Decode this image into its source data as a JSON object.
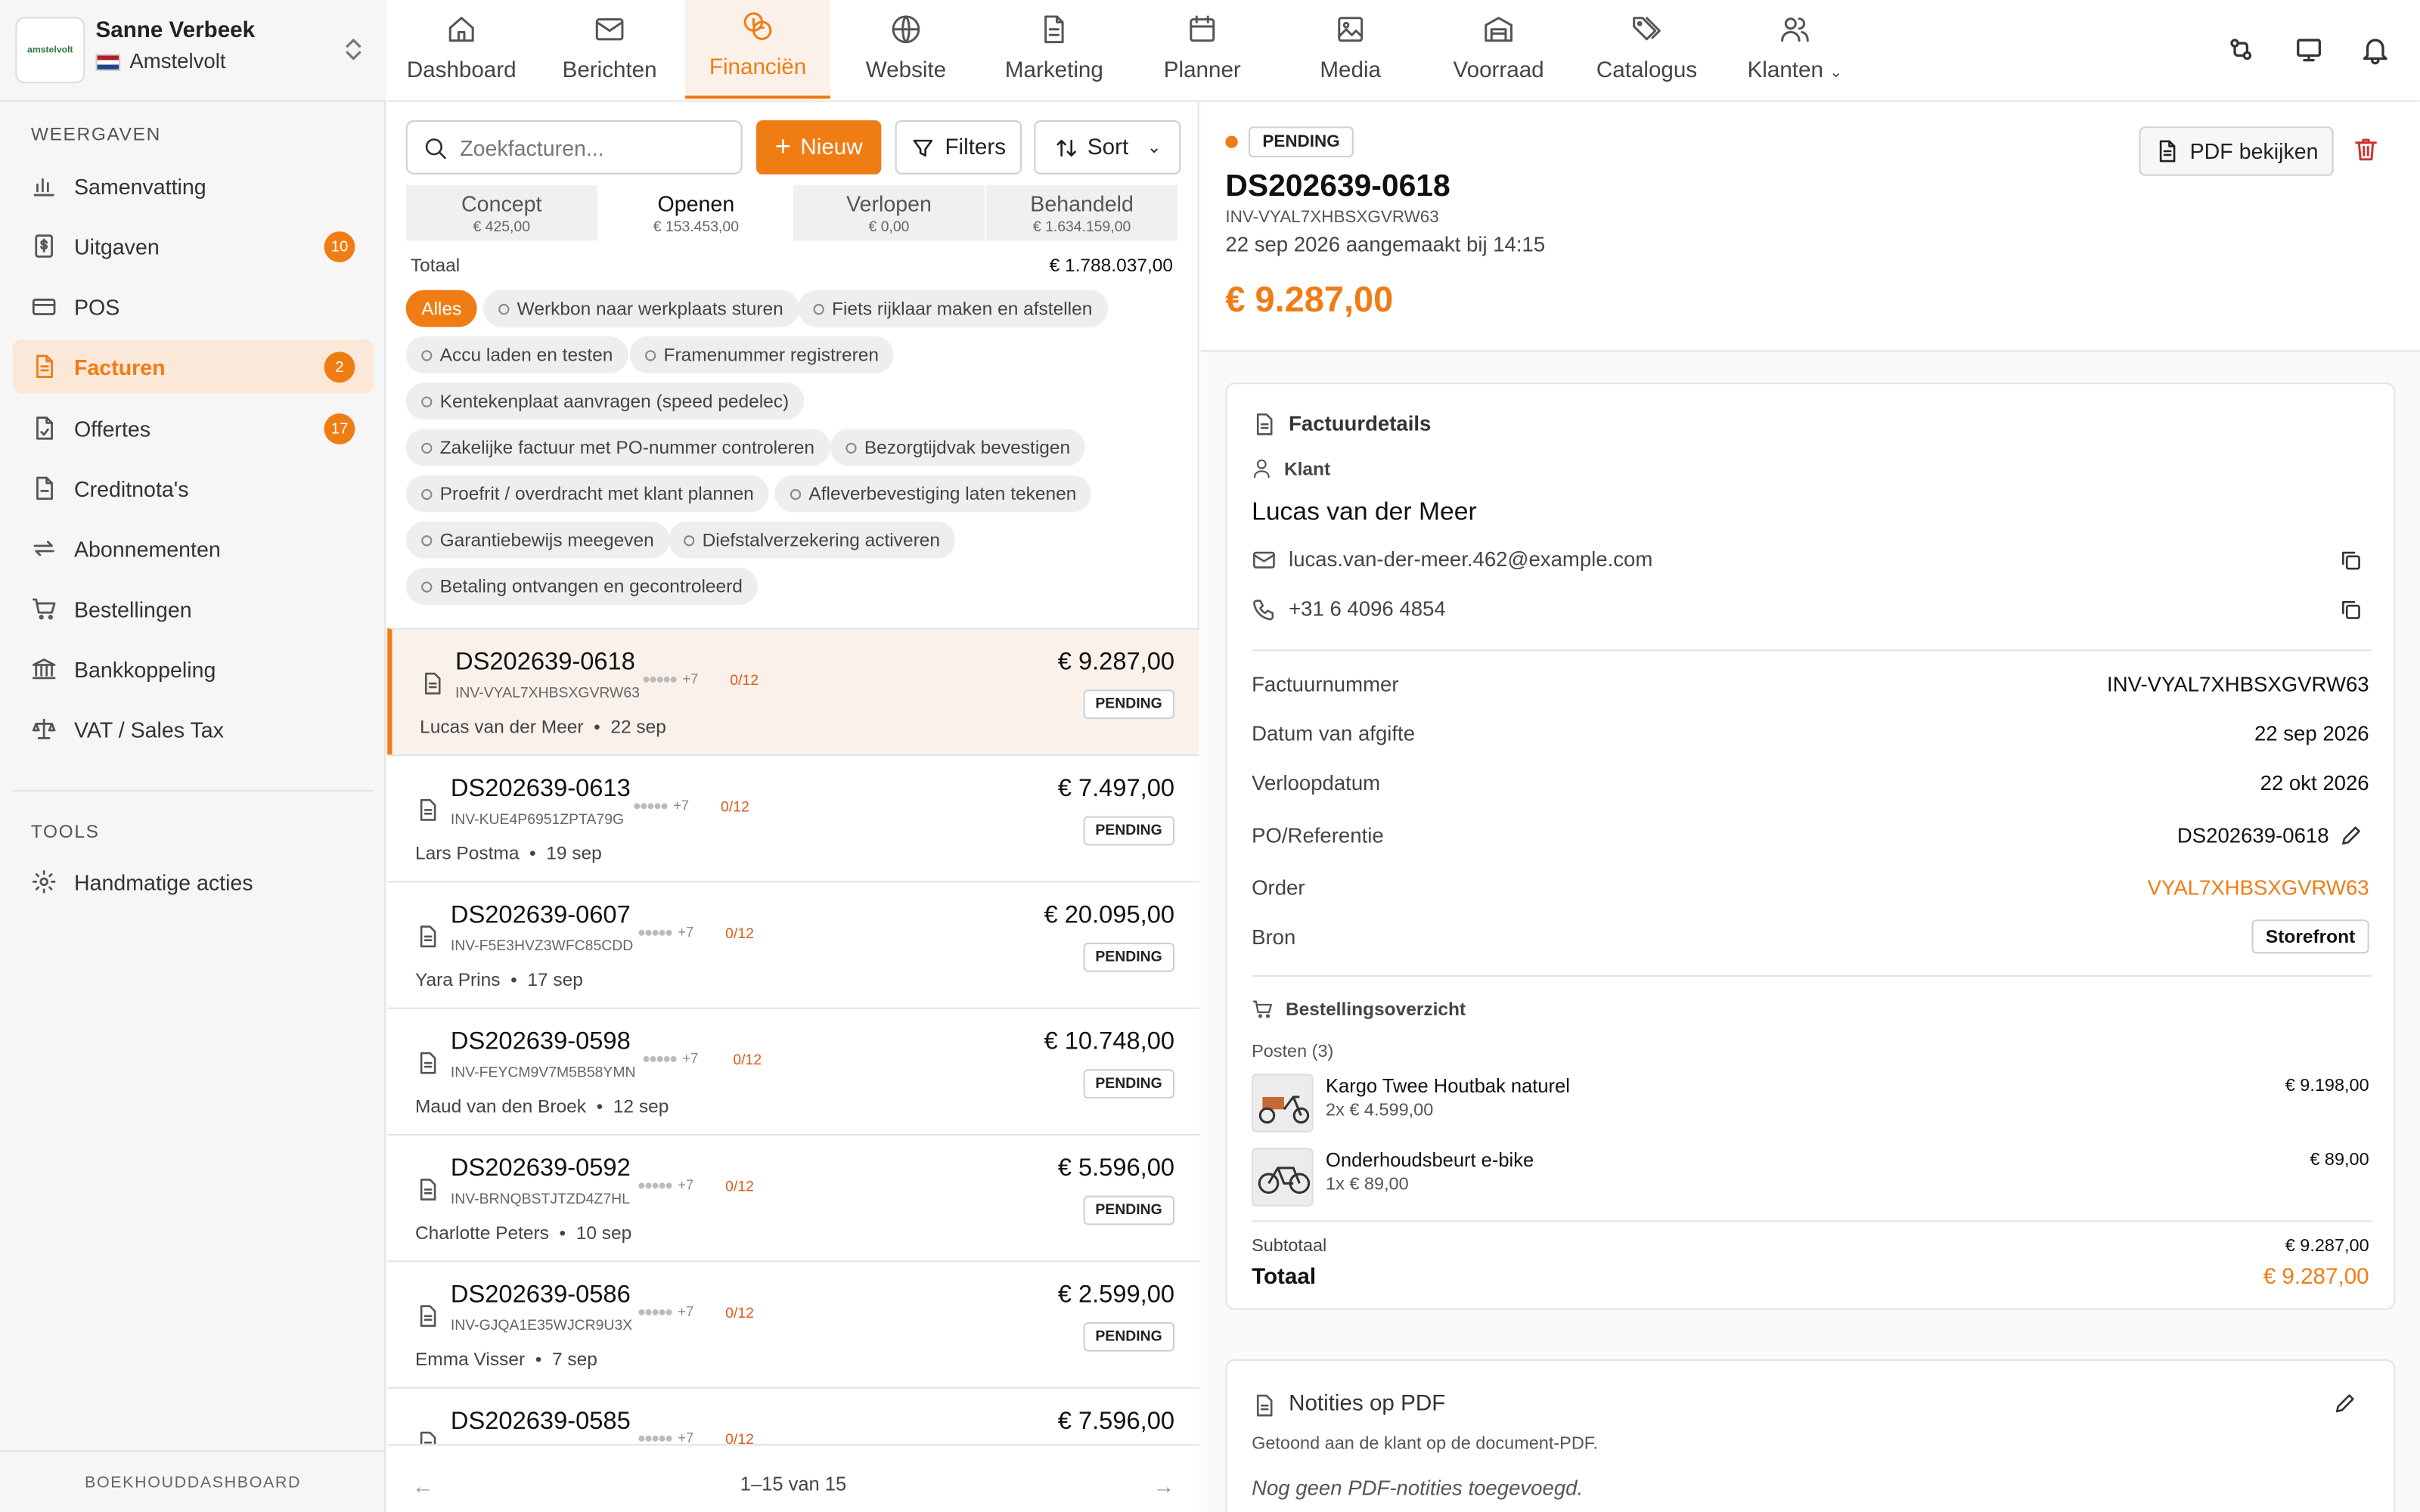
{
  "colors": {
    "accent": "#f07c14",
    "danger": "#d32f2f"
  },
  "store": {
    "user": "Sanne Verbeek",
    "store_name": "Amstelvolt",
    "logo_text": "amstelvolt"
  },
  "sidebar": {
    "section_views": "WEERGAVEN",
    "items": [
      {
        "label": "Samenvatting",
        "icon": "chart-icon"
      },
      {
        "label": "Uitgaven",
        "icon": "dollar-doc-icon",
        "badge": "10"
      },
      {
        "label": "POS",
        "icon": "card-icon"
      },
      {
        "label": "Facturen",
        "icon": "invoice-icon",
        "badge": "2"
      },
      {
        "label": "Offertes",
        "icon": "quote-icon",
        "badge": "17"
      },
      {
        "label": "Creditnota's",
        "icon": "credit-note-icon"
      },
      {
        "label": "Abonnementen",
        "icon": "repeat-icon"
      },
      {
        "label": "Bestellingen",
        "icon": "cart-icon"
      },
      {
        "label": "Bankkoppeling",
        "icon": "bank-icon"
      },
      {
        "label": "VAT / Sales Tax",
        "icon": "scale-icon"
      }
    ],
    "section_tools": "TOOLS",
    "tools": [
      {
        "label": "Handmatige acties",
        "icon": "gear-icon"
      }
    ],
    "footer": "BOEKHOUDDASHBOARD"
  },
  "topnav": {
    "tabs": [
      "Dashboard",
      "Berichten",
      "Financiën",
      "Website",
      "Marketing",
      "Planner",
      "Media",
      "Voorraad",
      "Catalogus",
      "Klanten"
    ]
  },
  "list": {
    "search_placeholder": "Zoekfacturen...",
    "new_label": "Nieuw",
    "filters_label": "Filters",
    "sort_label": "Sort",
    "segments": [
      {
        "label": "Concept",
        "value": "€ 425,00"
      },
      {
        "label": "Openen",
        "value": "€ 153.453,00"
      },
      {
        "label": "Verlopen",
        "value": "€ 0,00"
      },
      {
        "label": "Behandeld",
        "value": "€ 1.634.159,00"
      }
    ],
    "total_label": "Totaal",
    "total_value": "€ 1.788.037,00",
    "chips": [
      "Alles",
      "Werkbon naar werkplaats sturen",
      "Fiets rijklaar maken en afstellen",
      "Accu laden en testen",
      "Framenummer registreren",
      "Kentekenplaat aanvragen (speed pedelec)",
      "Zakelijke factuur met PO-nummer controleren",
      "Bezorgtijdvak bevestigen",
      "Proefrit / overdracht met klant plannen",
      "Afleverbevestiging laten tekenen",
      "Garantiebewijs meegeven",
      "Diefstalverzekering activeren",
      "Betaling ontvangen en gecontroleerd"
    ],
    "rows": [
      {
        "number": "DS202639-0618",
        "inv": "INV-VYAL7XHBSXGVRW63",
        "customer": "Lucas van der Meer",
        "date": "22 sep",
        "amount": "€ 9.287,00",
        "status": "PENDING",
        "extra": "+7",
        "progress": "0/12"
      },
      {
        "number": "DS202639-0613",
        "inv": "INV-KUE4P6951ZPTA79G",
        "customer": "Lars Postma",
        "date": "19 sep",
        "amount": "€ 7.497,00",
        "status": "PENDING",
        "extra": "+7",
        "progress": "0/12"
      },
      {
        "number": "DS202639-0607",
        "inv": "INV-F5E3HVZ3WFC85CDD",
        "customer": "Yara Prins",
        "date": "17 sep",
        "amount": "€ 20.095,00",
        "status": "PENDING",
        "extra": "+7",
        "progress": "0/12"
      },
      {
        "number": "DS202639-0598",
        "inv": "INV-FEYCM9V7M5B58YMN",
        "customer": "Maud van den Broek",
        "date": "12 sep",
        "amount": "€ 10.748,00",
        "status": "PENDING",
        "extra": "+7",
        "progress": "0/12"
      },
      {
        "number": "DS202639-0592",
        "inv": "INV-BRNQBSTJTZD4Z7HL",
        "customer": "Charlotte Peters",
        "date": "10 sep",
        "amount": "€ 5.596,00",
        "status": "PENDING",
        "extra": "+7",
        "progress": "0/12"
      },
      {
        "number": "DS202639-0586",
        "inv": "INV-GJQA1E35WJCR9U3X",
        "customer": "Emma Visser",
        "date": "7 sep",
        "amount": "€ 2.599,00",
        "status": "PENDING",
        "extra": "+7",
        "progress": "0/12"
      },
      {
        "number": "DS202639-0585",
        "inv": "",
        "customer": "",
        "date": "",
        "amount": "€ 7.596,00",
        "status": "",
        "extra": "+7",
        "progress": "0/12"
      }
    ],
    "pager": "1–15 van 15"
  },
  "detail": {
    "status": "PENDING",
    "number": "DS202639-0618",
    "inv": "INV-VYAL7XHBSXGVRW63",
    "created": "22 sep 2026 aangemaakt bij 14:15",
    "amount": "€ 9.287,00",
    "pdf_button": "PDF bekijken",
    "section_title": "Factuurdetails",
    "customer_label": "Klant",
    "customer_name": "Lucas van der Meer",
    "email": "lucas.van-der-meer.462@example.com",
    "phone": "+31 6 4096 4854",
    "fields": [
      {
        "label": "Factuurnummer",
        "value": "INV-VYAL7XHBSXGVRW63"
      },
      {
        "label": "Datum van afgifte",
        "value": "22 sep 2026"
      },
      {
        "label": "Verloopdatum",
        "value": "22 okt 2026"
      },
      {
        "label": "PO/Referentie",
        "value": "DS202639-0618"
      },
      {
        "label": "Order",
        "value": "VYAL7XHBSXGVRW63"
      },
      {
        "label": "Bron",
        "value": "Storefront"
      }
    ],
    "order_title": "Bestellingsoverzicht",
    "items_count": "Posten (3)",
    "items": [
      {
        "name": "Kargo Twee Houtbak naturel",
        "qty": "2x € 4.599,00",
        "total": "€ 9.198,00"
      },
      {
        "name": "Onderhoudsbeurt e-bike",
        "qty": "1x € 89,00",
        "total": "€ 89,00"
      }
    ],
    "subtotal_label": "Subtotaal",
    "subtotal": "€ 9.287,00",
    "total_label": "Totaal",
    "total": "€ 9.287,00",
    "notes_title": "Notities op PDF",
    "notes_desc": "Getoond aan de klant op de document-PDF.",
    "notes_empty": "Nog geen PDF-notities toegevoegd."
  }
}
